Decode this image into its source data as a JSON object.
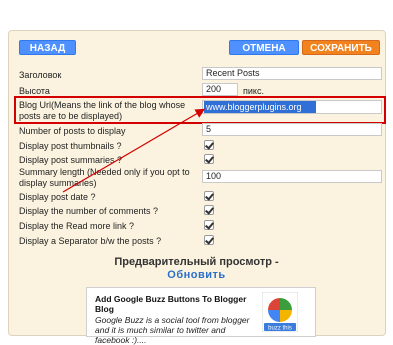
{
  "toolbar": {
    "back_label": "НАЗАД",
    "cancel_label": "ОТМЕНА",
    "save_label": "СОХРАНИТЬ"
  },
  "form": {
    "title_label": "Заголовок",
    "title_value": "Recent Posts",
    "height_label": "Высота",
    "height_value": "200",
    "height_unit": "пикс.",
    "blog_url_label": "Blog Url(Means the link of the blog whose posts are to be displayed)",
    "blog_url_value": "www.bloggerplugins.org",
    "num_posts_label": "Number of posts to display",
    "num_posts_value": "5",
    "thumbnails_label": "Display post thumbnails ?",
    "summaries_label": "Display post summaries ?",
    "summary_length_label": "Summary length (Needed only if you opt to display summaries)",
    "summary_length_value": "100",
    "post_date_label": "Display post date ?",
    "comments_label": "Display the number of comments ?",
    "read_more_label": "Display the Read more link ?",
    "separator_label": "Display a Separator b/w the posts ?"
  },
  "preview": {
    "title": "Предварительный просмотр -",
    "refresh_label": "Обновить"
  },
  "widget": {
    "post_title": "Add Google Buzz Buttons To Blogger Blog",
    "post_summary": "Google Buzz is a social tool from blogger and it is much similar to twitter and facebook :)....",
    "logo_caption": "buzz this"
  },
  "colors": {
    "blue_button": "#4d90fe",
    "orange_button": "#f2821d",
    "highlight_border": "#d40000",
    "link": "#2a6fc9"
  }
}
